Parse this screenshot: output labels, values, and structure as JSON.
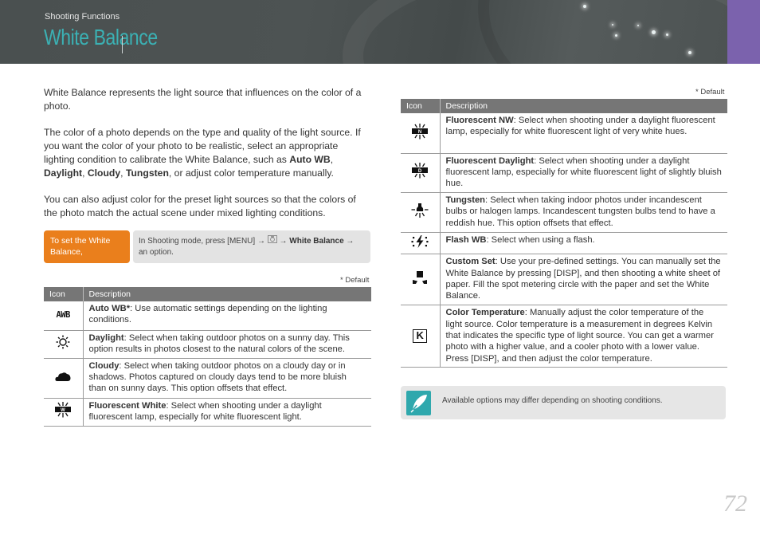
{
  "header": {
    "section": "Shooting Functions",
    "title": "White Balance",
    "accent_color": "#3bb1b4",
    "tab_color": "#7b62ad"
  },
  "intro": {
    "p1": "White Balance represents the light source that influences on the color of a photo.",
    "p2_a": "The color of a photo depends on the type and quality of the light source. If you want the color of your photo to be realistic, select an appropriate lighting condition to calibrate the White Balance, such as ",
    "p2_b1": "Auto WB",
    "p2_s1": ", ",
    "p2_b2": "Daylight",
    "p2_s2": ", ",
    "p2_b3": "Cloudy",
    "p2_s3": ", ",
    "p2_b4": "Tungsten",
    "p2_end": ", or adjust color temperature manually.",
    "p3": "You can also adjust color for the preset light sources so that the colors of the photo match the actual scene under mixed lighting conditions."
  },
  "howto": {
    "label": "To set the White Balance,",
    "text_a": "In Shooting mode, press [MENU] → ",
    "camera_icon": "camera-icon",
    "text_b": " → ",
    "bold": "White Balance",
    "text_c": " → an option.",
    "label_color": "#ea7f1c"
  },
  "default_note": "* Default",
  "table_headers": {
    "icon": "Icon",
    "description": "Description"
  },
  "left_table": [
    {
      "icon": "awb-icon",
      "name": "Auto WB*",
      "desc": ": Use automatic settings depending on the lighting conditions."
    },
    {
      "icon": "daylight-icon",
      "name": "Daylight",
      "desc": ": Select when taking outdoor photos on a sunny day. This option results in photos closest to the natural colors of the scene."
    },
    {
      "icon": "cloudy-icon",
      "name": "Cloudy",
      "desc": ": Select when taking outdoor photos on a cloudy day or in shadows. Photos captured on cloudy days tend to be more bluish than on sunny days. This option offsets that effect."
    },
    {
      "icon": "fluorescent-white-icon",
      "name": "Fluorescent White",
      "desc": ": Select when shooting under a daylight fluorescent lamp, especially for white fluorescent light."
    }
  ],
  "right_table": [
    {
      "icon": "fluorescent-nw-icon",
      "name": "Fluorescent NW",
      "desc": ": Select when shooting under a daylight fluorescent lamp, especially for white fluorescent light of very white hues."
    },
    {
      "icon": "fluorescent-daylight-icon",
      "name": "Fluorescent Daylight",
      "desc": ": Select when shooting under a daylight fluorescent lamp, especially for white fluorescent light of slightly bluish hue."
    },
    {
      "icon": "tungsten-icon",
      "name": "Tungsten",
      "desc": ": Select when taking indoor photos under incandescent bulbs or halogen lamps. Incandescent tungsten bulbs tend to have a reddish hue. This option offsets that effect."
    },
    {
      "icon": "flash-wb-icon",
      "name": "Flash WB",
      "desc": ": Select when using a flash."
    },
    {
      "icon": "custom-set-icon",
      "name": "Custom Set",
      "desc": ": Use your pre-defined settings. You can manually set the White Balance by pressing [DISP], and then shooting a white sheet of paper. Fill the spot metering circle with the paper and set the White Balance."
    },
    {
      "icon": "color-temperature-icon",
      "name": "Color Temperature",
      "desc": ": Manually adjust the color temperature of the light source. Color temperature is a measurement in degrees Kelvin that indicates the specific type of light source. You can get a warmer photo with a higher value, and a cooler photo with a lower value. Press [DISP], and then adjust the color temperature."
    }
  ],
  "icon_glyphs": {
    "awb": "AWB",
    "fluor_white": "W",
    "fluor_nw": "N",
    "fluor_day": "D",
    "kelvin": "K"
  },
  "note": {
    "icon": "pen-note-icon",
    "text": "Available options may differ depending on shooting conditions."
  },
  "page_number": "72"
}
